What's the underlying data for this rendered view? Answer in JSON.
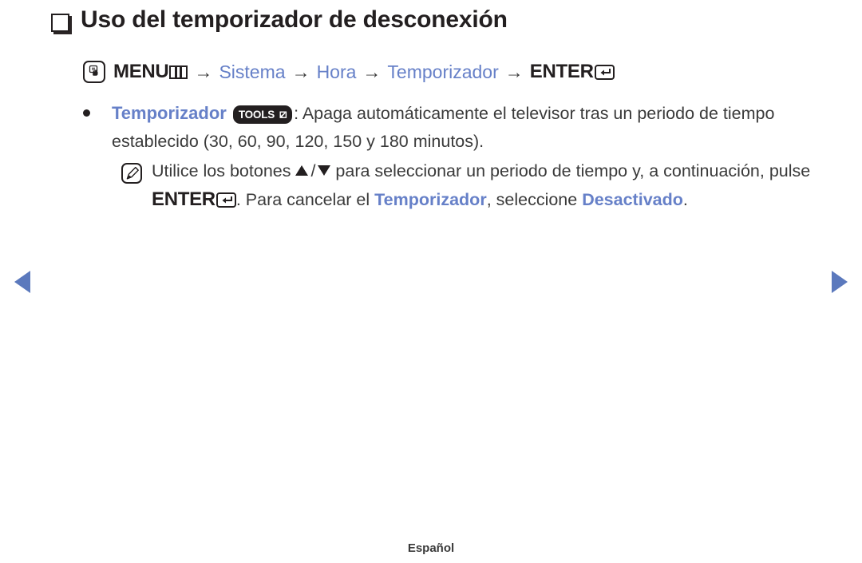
{
  "heading": {
    "bullet_icon": "hollow-square-icon",
    "title": "Uso del temporizador de desconexión"
  },
  "menu_path": {
    "menu_icon": "hand-press-icon",
    "menu_label": "MENU",
    "menu_glyph_icon": "menu-bars-icon",
    "arrow": "→",
    "step1": "Sistema",
    "step2": "Hora",
    "step3": "Temporizador",
    "enter_label": "ENTER",
    "enter_glyph_icon": "enter-return-icon"
  },
  "content": {
    "bullet": {
      "term": "Temporizador",
      "tools_badge_label": "TOOLS",
      "tools_badge_glyph": "tools-arrow-icon",
      "text_after_badge": ": Apaga automáticamente el televisor tras un periodo de tiempo establecido (30, 60, 90, 120, 150 y 180 minutos)."
    },
    "note": {
      "note_icon": "pencil-note-icon",
      "part1": "Utilice los botones ",
      "up_arrow_icon": "triangle-up-icon",
      "slash": "/",
      "down_arrow_icon": "triangle-down-icon",
      "part2": " para seleccionar un periodo de tiempo y, a continuación, pulse ",
      "enter_label": "ENTER",
      "enter_glyph_icon": "enter-return-icon",
      "part3": ". Para cancelar el ",
      "highlight1": "Temporizador",
      "part4": ", seleccione ",
      "highlight2": "Desactivado",
      "part5": "."
    }
  },
  "navigation": {
    "prev_icon": "triangle-left-icon",
    "next_icon": "triangle-right-icon"
  },
  "footer": {
    "language": "Español"
  },
  "colors": {
    "link_blue": "#6680c8",
    "nav_arrow_blue": "#5b79bd",
    "text_dark": "#231f20"
  }
}
